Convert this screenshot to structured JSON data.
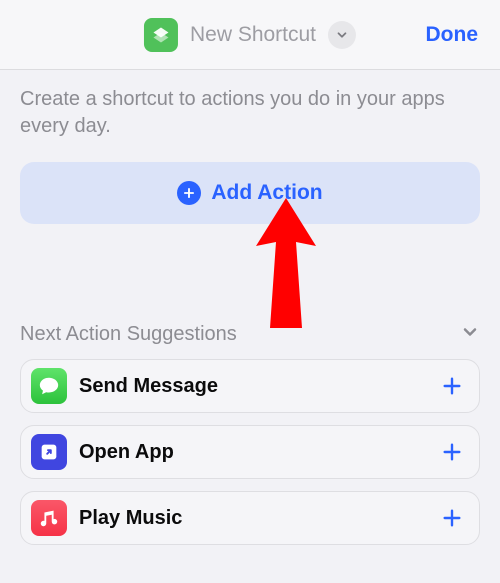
{
  "header": {
    "title": "New Shortcut",
    "done_label": "Done"
  },
  "instruction_text": "Create a shortcut to actions you do in your apps every day.",
  "add_action_label": "Add Action",
  "suggestions": {
    "title": "Next Action Suggestions",
    "items": [
      {
        "label": "Send Message",
        "icon": "messages-icon"
      },
      {
        "label": "Open App",
        "icon": "shortcuts-icon"
      },
      {
        "label": "Play Music",
        "icon": "music-icon"
      }
    ]
  },
  "colors": {
    "accent": "#2a62ff",
    "shortcut_icon_bg": "#50c15a",
    "add_action_bg": "#dbe3f8",
    "annotation_arrow": "#ff0000"
  }
}
